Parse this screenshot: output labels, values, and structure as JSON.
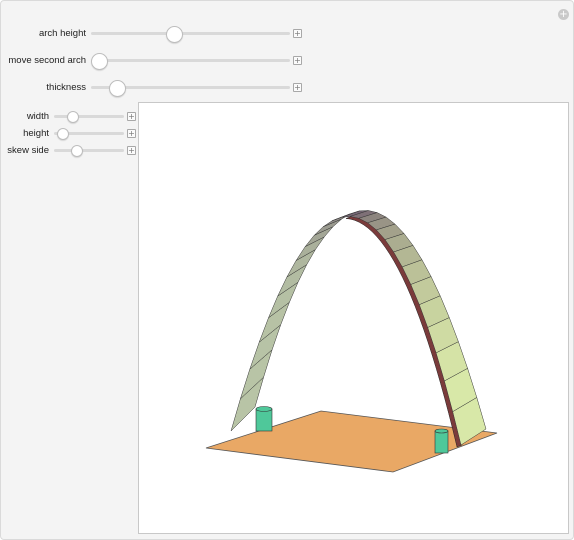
{
  "controls": {
    "main_sliders": [
      {
        "label": "arch height",
        "value": 0.41
      },
      {
        "label": "move second arch",
        "value": 0.0
      },
      {
        "label": "thickness",
        "value": 0.1
      }
    ],
    "sub_sliders": [
      {
        "label": "width",
        "value": 0.22
      },
      {
        "label": "height",
        "value": 0.05
      },
      {
        "label": "skew side",
        "value": 0.29
      }
    ],
    "plus_glyph": "+",
    "corner_plus_glyph": "+"
  },
  "scene": {
    "floor_color": "#e9a865",
    "pier_color": "#4fc89a",
    "left_leg_color": "#b8c4a6",
    "apex_color": "#6d5a6e",
    "right_leg_color": "#d8e8a8",
    "arch_edge_color": "#7a3b3b"
  }
}
